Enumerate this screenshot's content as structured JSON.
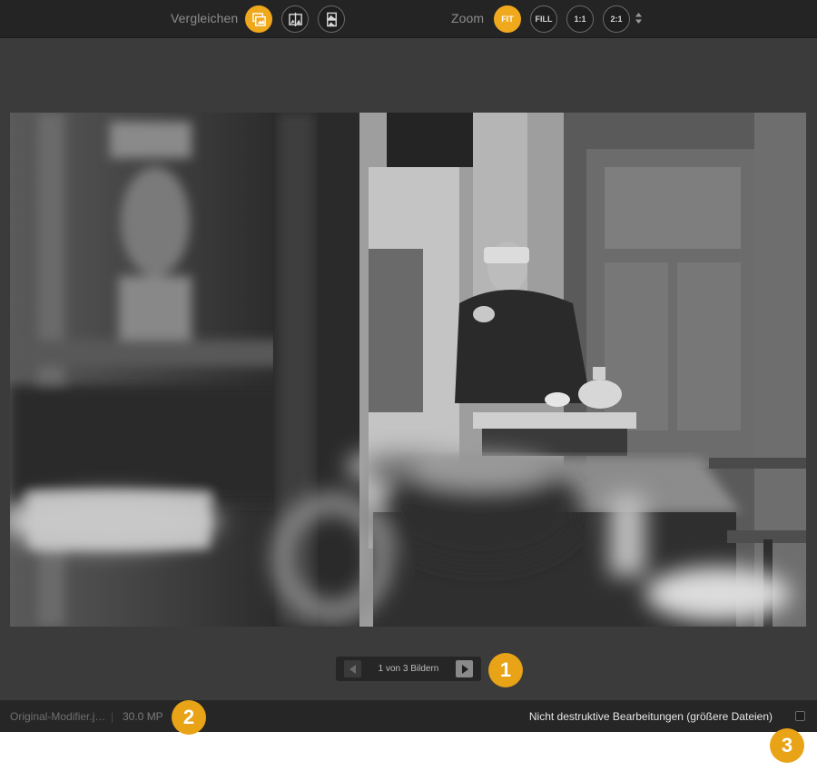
{
  "toolbar": {
    "compare_label": "Vergleichen",
    "zoom_label": "Zoom",
    "zoom_buttons": [
      "FIT",
      "FILL",
      "1:1",
      "2:1"
    ],
    "active_zoom": "FIT"
  },
  "navigator": {
    "text": "1 von 3 Bildern"
  },
  "statusbar": {
    "filename": "Original-Modifier.j…",
    "separator": "|",
    "megapixels": "30.0 MP",
    "nondestructive_label": "Nicht destruktive Bearbeitungen (größere Dateien)",
    "nondestructive_checked": false
  },
  "badges": [
    "1",
    "2",
    "3"
  ],
  "colors": {
    "accent": "#f0a81c",
    "badge": "#e8a317",
    "background": "#3b3b3b",
    "bar": "#242424"
  },
  "icons": [
    "side-by-side-icon",
    "split-view-icon",
    "stacked-view-icon",
    "sort-arrows-icon",
    "prev-arrow-icon",
    "next-arrow-icon"
  ]
}
